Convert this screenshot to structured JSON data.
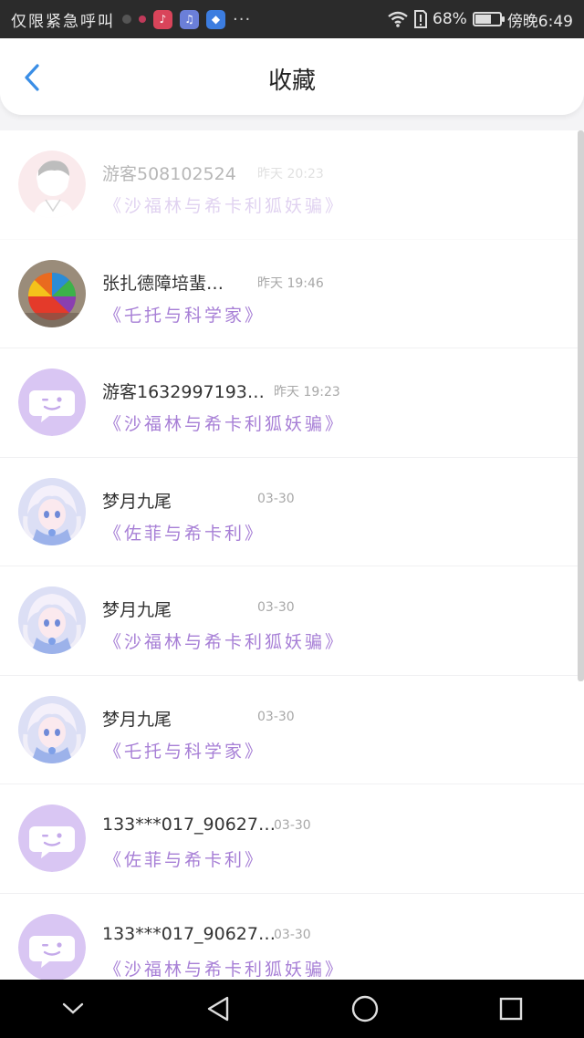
{
  "status_bar": {
    "carrier": "仅限紧急呼叫",
    "battery": "68%",
    "battery_level": 0.68,
    "time": "傍晚6:49"
  },
  "header": {
    "title": "收藏"
  },
  "items": [
    {
      "name": "游客508102524",
      "time": "昨天 20:23",
      "title": "《沙福林与希卡利狐妖骗》",
      "avatar": "boy-sketch",
      "faded": true
    },
    {
      "name": "张扎德障培蜚…",
      "time": "昨天 19:46",
      "title": "《乇托与科学家》",
      "avatar": "umbrella"
    },
    {
      "name": "游客1632997193…",
      "time": "昨天 19:23",
      "title": "《沙福林与希卡利狐妖骗》",
      "avatar": "default-chat"
    },
    {
      "name": "梦月九尾",
      "time": "03-30",
      "title": "《佐菲与希卡利》",
      "avatar": "anime-girl"
    },
    {
      "name": "梦月九尾",
      "time": "03-30",
      "title": "《沙福林与希卡利狐妖骗》",
      "avatar": "anime-girl"
    },
    {
      "name": "梦月九尾",
      "time": "03-30",
      "title": "《乇托与科学家》",
      "avatar": "anime-girl"
    },
    {
      "name": "133***017_90627…",
      "time": "03-30",
      "title": "《佐菲与希卡利》",
      "avatar": "default-chat"
    },
    {
      "name": "133***017_90627…",
      "time": "03-30",
      "title": "《沙福林与希卡利狐妖骗》",
      "avatar": "default-chat"
    }
  ],
  "colors": {
    "accent": "#a77fd6",
    "avatar_default": "#d9c6f3",
    "back_arrow": "#3a8ee6"
  }
}
